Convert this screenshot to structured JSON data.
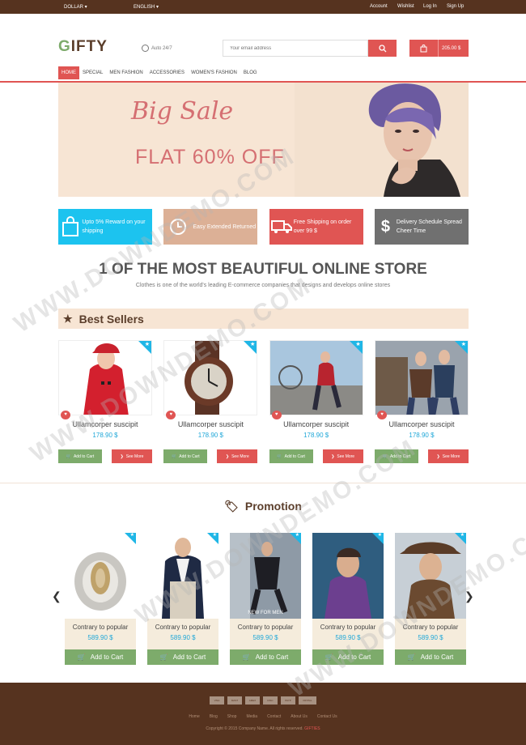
{
  "topbar": {
    "currency": "DOLLAR",
    "language": "ENGLISH",
    "links": [
      "Account",
      "Wishlist",
      "Log In",
      "Sign Up"
    ]
  },
  "header": {
    "logo": "GIFTY",
    "support": "Auto 24/7",
    "search_placeholder": "Your email address",
    "cart_total": "205.00 $"
  },
  "nav": [
    "HOME",
    "SPECIAL",
    "MEN FASHION",
    "ACCESSORIES",
    "WOMEN'S FASHION",
    "BLOG"
  ],
  "banner": {
    "title": "Big Sale",
    "subtitle": "FLAT 60% OFF"
  },
  "features": [
    {
      "text": "Upto 5% Reward on your shipping",
      "color": "#1cc3ef",
      "icon": "bag-icon"
    },
    {
      "text": "Easy Extended Returned",
      "color": "#dcb096",
      "icon": "clock-icon"
    },
    {
      "text": "Free Shipping on order over 99 $",
      "color": "#e05553",
      "icon": "truck-icon"
    },
    {
      "text": "Delivery Schedule Spread Cheer Time",
      "color": "#707070",
      "icon": "dollar-icon"
    }
  ],
  "headline": "1 OF THE MOST BEAUTIFUL ONLINE STORE",
  "subline": "Clothes is one of the world's leading E-commerce companies that designs and develops online stores",
  "best_sellers": {
    "title": "Best Sellers",
    "add_label": "Add to Cart",
    "see_label": "See More",
    "products": [
      {
        "name": "Ullamcorper suscipit",
        "price": "178.90 $"
      },
      {
        "name": "Ullamcorper suscipit",
        "price": "178.90 $"
      },
      {
        "name": "Ullamcorper suscipit",
        "price": "178.90 $"
      },
      {
        "name": "Ullamcorper suscipit",
        "price": "178.90 $"
      }
    ]
  },
  "promotion": {
    "title": "Promotion",
    "add_label": "Add to Cart",
    "items": [
      {
        "name": "Contrary to popular",
        "price": "589.90 $"
      },
      {
        "name": "Contrary to popular",
        "price": "589.90 $"
      },
      {
        "name": "Contrary to popular",
        "price": "589.90 $"
      },
      {
        "name": "Contrary to popular",
        "price": "589.90 $"
      },
      {
        "name": "Contrary to popular",
        "price": "589.90 $"
      }
    ],
    "photo_caption": "NEW FOR MEN"
  },
  "footer": {
    "payments": [
      "VISA",
      "MAST",
      "AMEX",
      "DISC",
      "PAYP",
      "PAYPAL"
    ],
    "links": [
      "Home",
      "Blog",
      "Shop",
      "Media",
      "Contact",
      "About Us",
      "Contact Us"
    ],
    "copyright": "Copyright © 2015 Company Name. All rights reserved.",
    "brand": "GIFTIES"
  },
  "watermark": "WWW.DOWNDEMO.COM"
}
